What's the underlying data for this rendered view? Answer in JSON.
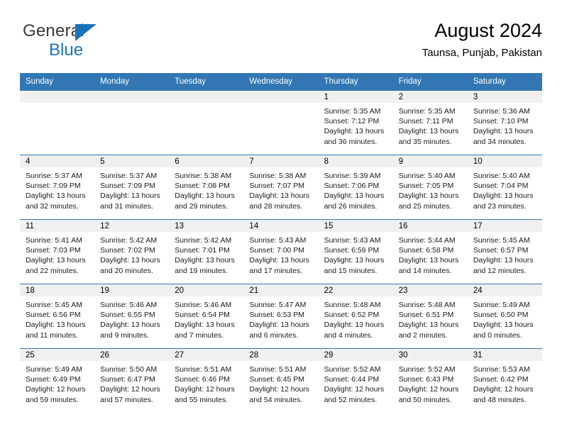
{
  "brand": {
    "name_top": "General",
    "name_bottom": "Blue",
    "accent_color": "#1c72b8"
  },
  "header": {
    "title": "August 2024",
    "subtitle": "Taunsa, Punjab, Pakistan"
  },
  "calendar": {
    "header_bg": "#3277b3",
    "daynum_bg": "#f0f0f0",
    "weekday_headers": [
      "Sunday",
      "Monday",
      "Tuesday",
      "Wednesday",
      "Thursday",
      "Friday",
      "Saturday"
    ],
    "weeks": [
      [
        {
          "day": "",
          "sunrise": "",
          "sunset": "",
          "daylight_line1": "",
          "daylight_line2": ""
        },
        {
          "day": "",
          "sunrise": "",
          "sunset": "",
          "daylight_line1": "",
          "daylight_line2": ""
        },
        {
          "day": "",
          "sunrise": "",
          "sunset": "",
          "daylight_line1": "",
          "daylight_line2": ""
        },
        {
          "day": "",
          "sunrise": "",
          "sunset": "",
          "daylight_line1": "",
          "daylight_line2": ""
        },
        {
          "day": "1",
          "sunrise": "Sunrise: 5:35 AM",
          "sunset": "Sunset: 7:12 PM",
          "daylight_line1": "Daylight: 13 hours",
          "daylight_line2": "and 36 minutes."
        },
        {
          "day": "2",
          "sunrise": "Sunrise: 5:35 AM",
          "sunset": "Sunset: 7:11 PM",
          "daylight_line1": "Daylight: 13 hours",
          "daylight_line2": "and 35 minutes."
        },
        {
          "day": "3",
          "sunrise": "Sunrise: 5:36 AM",
          "sunset": "Sunset: 7:10 PM",
          "daylight_line1": "Daylight: 13 hours",
          "daylight_line2": "and 34 minutes."
        }
      ],
      [
        {
          "day": "4",
          "sunrise": "Sunrise: 5:37 AM",
          "sunset": "Sunset: 7:09 PM",
          "daylight_line1": "Daylight: 13 hours",
          "daylight_line2": "and 32 minutes."
        },
        {
          "day": "5",
          "sunrise": "Sunrise: 5:37 AM",
          "sunset": "Sunset: 7:09 PM",
          "daylight_line1": "Daylight: 13 hours",
          "daylight_line2": "and 31 minutes."
        },
        {
          "day": "6",
          "sunrise": "Sunrise: 5:38 AM",
          "sunset": "Sunset: 7:08 PM",
          "daylight_line1": "Daylight: 13 hours",
          "daylight_line2": "and 29 minutes."
        },
        {
          "day": "7",
          "sunrise": "Sunrise: 5:38 AM",
          "sunset": "Sunset: 7:07 PM",
          "daylight_line1": "Daylight: 13 hours",
          "daylight_line2": "and 28 minutes."
        },
        {
          "day": "8",
          "sunrise": "Sunrise: 5:39 AM",
          "sunset": "Sunset: 7:06 PM",
          "daylight_line1": "Daylight: 13 hours",
          "daylight_line2": "and 26 minutes."
        },
        {
          "day": "9",
          "sunrise": "Sunrise: 5:40 AM",
          "sunset": "Sunset: 7:05 PM",
          "daylight_line1": "Daylight: 13 hours",
          "daylight_line2": "and 25 minutes."
        },
        {
          "day": "10",
          "sunrise": "Sunrise: 5:40 AM",
          "sunset": "Sunset: 7:04 PM",
          "daylight_line1": "Daylight: 13 hours",
          "daylight_line2": "and 23 minutes."
        }
      ],
      [
        {
          "day": "11",
          "sunrise": "Sunrise: 5:41 AM",
          "sunset": "Sunset: 7:03 PM",
          "daylight_line1": "Daylight: 13 hours",
          "daylight_line2": "and 22 minutes."
        },
        {
          "day": "12",
          "sunrise": "Sunrise: 5:42 AM",
          "sunset": "Sunset: 7:02 PM",
          "daylight_line1": "Daylight: 13 hours",
          "daylight_line2": "and 20 minutes."
        },
        {
          "day": "13",
          "sunrise": "Sunrise: 5:42 AM",
          "sunset": "Sunset: 7:01 PM",
          "daylight_line1": "Daylight: 13 hours",
          "daylight_line2": "and 19 minutes."
        },
        {
          "day": "14",
          "sunrise": "Sunrise: 5:43 AM",
          "sunset": "Sunset: 7:00 PM",
          "daylight_line1": "Daylight: 13 hours",
          "daylight_line2": "and 17 minutes."
        },
        {
          "day": "15",
          "sunrise": "Sunrise: 5:43 AM",
          "sunset": "Sunset: 6:59 PM",
          "daylight_line1": "Daylight: 13 hours",
          "daylight_line2": "and 15 minutes."
        },
        {
          "day": "16",
          "sunrise": "Sunrise: 5:44 AM",
          "sunset": "Sunset: 6:58 PM",
          "daylight_line1": "Daylight: 13 hours",
          "daylight_line2": "and 14 minutes."
        },
        {
          "day": "17",
          "sunrise": "Sunrise: 5:45 AM",
          "sunset": "Sunset: 6:57 PM",
          "daylight_line1": "Daylight: 13 hours",
          "daylight_line2": "and 12 minutes."
        }
      ],
      [
        {
          "day": "18",
          "sunrise": "Sunrise: 5:45 AM",
          "sunset": "Sunset: 6:56 PM",
          "daylight_line1": "Daylight: 13 hours",
          "daylight_line2": "and 11 minutes."
        },
        {
          "day": "19",
          "sunrise": "Sunrise: 5:46 AM",
          "sunset": "Sunset: 6:55 PM",
          "daylight_line1": "Daylight: 13 hours",
          "daylight_line2": "and 9 minutes."
        },
        {
          "day": "20",
          "sunrise": "Sunrise: 5:46 AM",
          "sunset": "Sunset: 6:54 PM",
          "daylight_line1": "Daylight: 13 hours",
          "daylight_line2": "and 7 minutes."
        },
        {
          "day": "21",
          "sunrise": "Sunrise: 5:47 AM",
          "sunset": "Sunset: 6:53 PM",
          "daylight_line1": "Daylight: 13 hours",
          "daylight_line2": "and 6 minutes."
        },
        {
          "day": "22",
          "sunrise": "Sunrise: 5:48 AM",
          "sunset": "Sunset: 6:52 PM",
          "daylight_line1": "Daylight: 13 hours",
          "daylight_line2": "and 4 minutes."
        },
        {
          "day": "23",
          "sunrise": "Sunrise: 5:48 AM",
          "sunset": "Sunset: 6:51 PM",
          "daylight_line1": "Daylight: 13 hours",
          "daylight_line2": "and 2 minutes."
        },
        {
          "day": "24",
          "sunrise": "Sunrise: 5:49 AM",
          "sunset": "Sunset: 6:50 PM",
          "daylight_line1": "Daylight: 13 hours",
          "daylight_line2": "and 0 minutes."
        }
      ],
      [
        {
          "day": "25",
          "sunrise": "Sunrise: 5:49 AM",
          "sunset": "Sunset: 6:49 PM",
          "daylight_line1": "Daylight: 12 hours",
          "daylight_line2": "and 59 minutes."
        },
        {
          "day": "26",
          "sunrise": "Sunrise: 5:50 AM",
          "sunset": "Sunset: 6:47 PM",
          "daylight_line1": "Daylight: 12 hours",
          "daylight_line2": "and 57 minutes."
        },
        {
          "day": "27",
          "sunrise": "Sunrise: 5:51 AM",
          "sunset": "Sunset: 6:46 PM",
          "daylight_line1": "Daylight: 12 hours",
          "daylight_line2": "and 55 minutes."
        },
        {
          "day": "28",
          "sunrise": "Sunrise: 5:51 AM",
          "sunset": "Sunset: 6:45 PM",
          "daylight_line1": "Daylight: 12 hours",
          "daylight_line2": "and 54 minutes."
        },
        {
          "day": "29",
          "sunrise": "Sunrise: 5:52 AM",
          "sunset": "Sunset: 6:44 PM",
          "daylight_line1": "Daylight: 12 hours",
          "daylight_line2": "and 52 minutes."
        },
        {
          "day": "30",
          "sunrise": "Sunrise: 5:52 AM",
          "sunset": "Sunset: 6:43 PM",
          "daylight_line1": "Daylight: 12 hours",
          "daylight_line2": "and 50 minutes."
        },
        {
          "day": "31",
          "sunrise": "Sunrise: 5:53 AM",
          "sunset": "Sunset: 6:42 PM",
          "daylight_line1": "Daylight: 12 hours",
          "daylight_line2": "and 48 minutes."
        }
      ]
    ]
  }
}
